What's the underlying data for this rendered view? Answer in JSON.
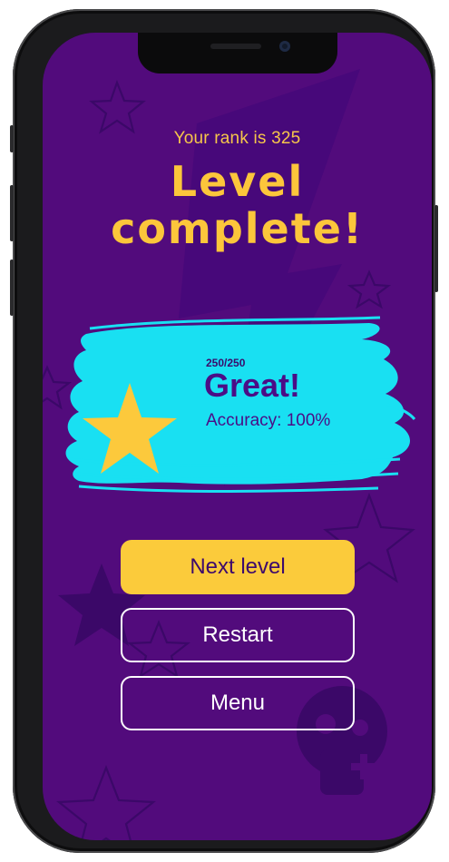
{
  "colors": {
    "background": "#520b7c",
    "accent_yellow": "#fcc63b",
    "card_cyan": "#19e0f2",
    "text_purple": "#4b0d86"
  },
  "header": {
    "rank_text": "Your rank is 325",
    "title_line1": "Level",
    "title_line2": "complete!"
  },
  "result": {
    "score": "250/250",
    "rating": "Great!",
    "accuracy": "Accuracy: 100%",
    "icon": "star-icon"
  },
  "buttons": {
    "next": "Next level",
    "restart": "Restart",
    "menu": "Menu"
  },
  "decorations": [
    "lightning-bolt",
    "star-outline",
    "skull-icon"
  ]
}
